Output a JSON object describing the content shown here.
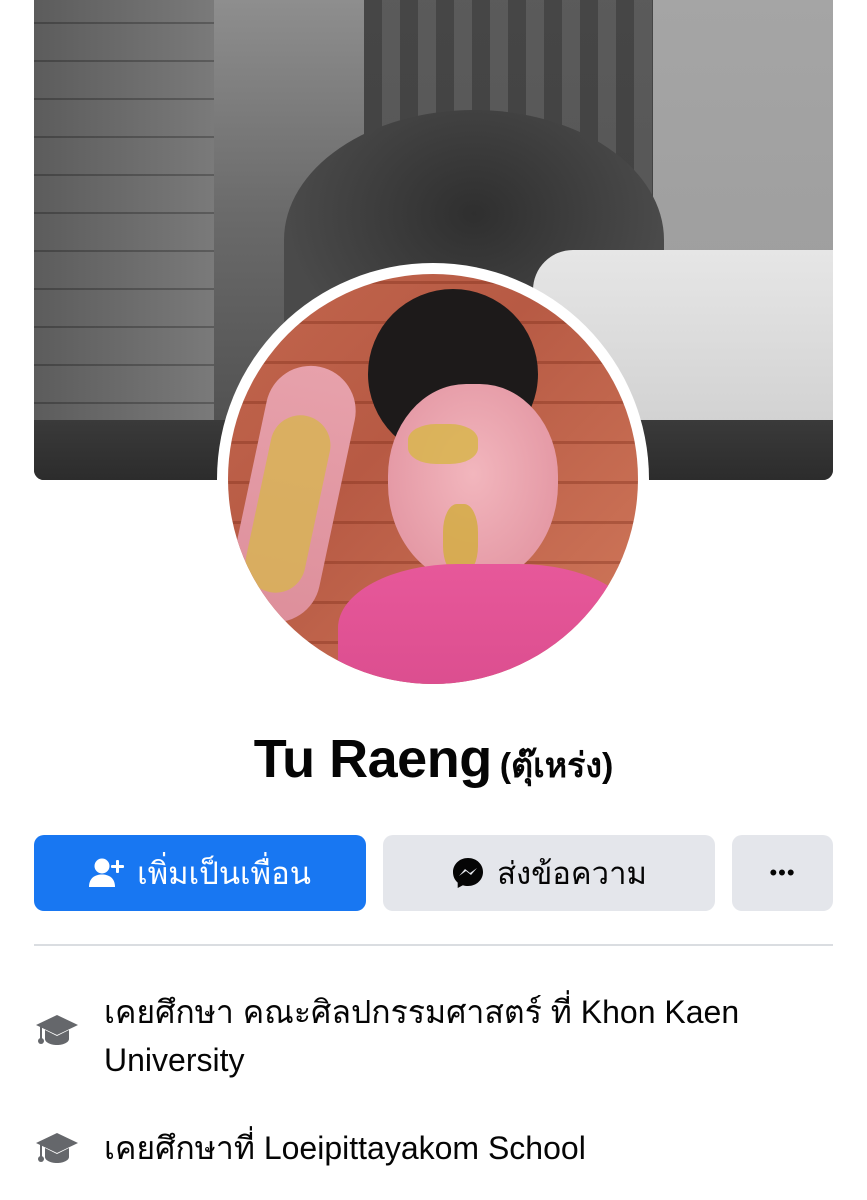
{
  "profile": {
    "name": "Tu Raeng",
    "alternate_name": "(ตุ๊เหร่ง)"
  },
  "actions": {
    "add_friend_label": "เพิ่มเป็นเพื่อน",
    "message_label": "ส่งข้อความ",
    "more_label": "•••"
  },
  "about": {
    "education": [
      {
        "text": "เคยศึกษา คณะศิลปกรรมศาสตร์ ที่ Khon Kaen University",
        "icon": "graduation-cap-icon"
      },
      {
        "text": "เคยศึกษาที่ Loeipittayakom School",
        "icon": "graduation-cap-icon"
      }
    ]
  },
  "colors": {
    "primary": "#1877f2",
    "secondary_button": "#e4e6eb",
    "divider": "#dadde1",
    "icon_gray": "#65676b"
  }
}
